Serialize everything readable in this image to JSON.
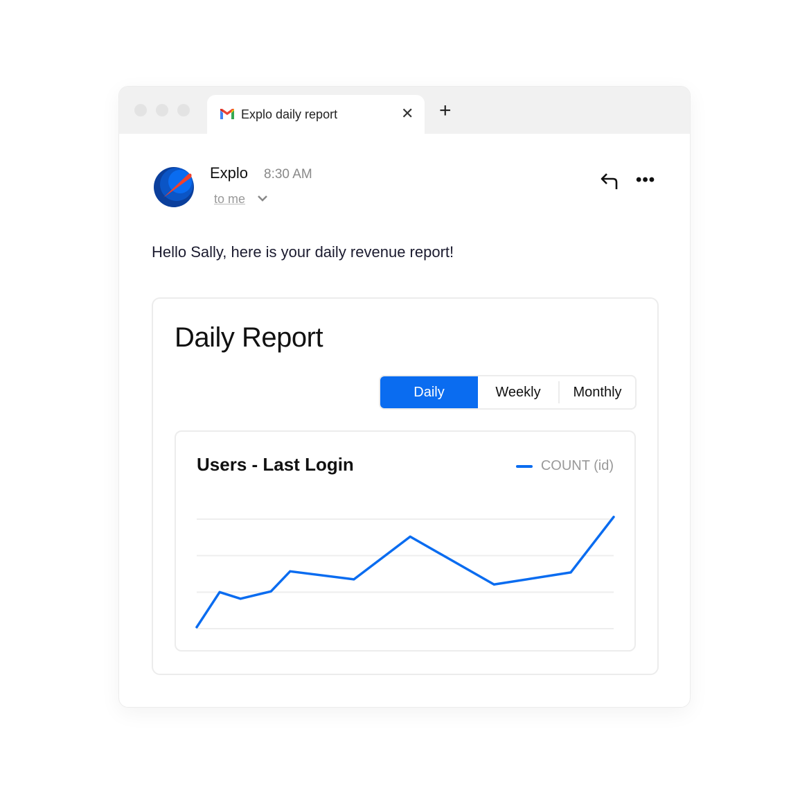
{
  "browser": {
    "tab_title": "Explo daily report",
    "tab_icon": "gmail-icon",
    "close_icon": "close-icon",
    "new_tab_icon": "plus-icon"
  },
  "email": {
    "sender": "Explo",
    "time": "8:30 AM",
    "recipient_label": "to me",
    "greeting": "Hello Sally, here is your daily revenue report!",
    "actions": [
      "reply-icon",
      "more-icon"
    ]
  },
  "report": {
    "title": "Daily Report",
    "periods": [
      {
        "label": "Daily",
        "active": true
      },
      {
        "label": "Weekly",
        "active": false
      },
      {
        "label": "Monthly",
        "active": false
      }
    ]
  },
  "colors": {
    "accent": "#0a6cf0",
    "gridline": "#eeeeee"
  },
  "chart_data": {
    "type": "line",
    "title": "Users - Last Login",
    "xlabel": "",
    "ylabel": "",
    "grid": true,
    "legend": "top-right",
    "ylim": [
      0,
      3
    ],
    "yticks": [
      0,
      1,
      2,
      3
    ],
    "x": [
      0,
      0.055,
      0.105,
      0.178,
      0.224,
      0.377,
      0.512,
      0.713,
      0.897,
      1.0
    ],
    "series": [
      {
        "name": "COUNT (id)",
        "color": "#0a6cf0",
        "values": [
          0.04,
          1.0,
          0.82,
          1.02,
          1.57,
          1.35,
          2.52,
          1.21,
          1.54,
          3.06
        ]
      }
    ]
  }
}
